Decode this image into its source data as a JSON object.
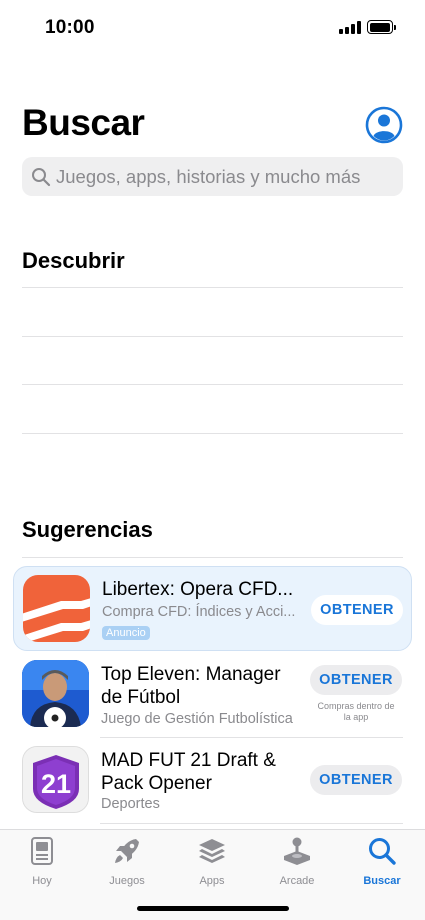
{
  "status_bar": {
    "time": "10:00"
  },
  "header": {
    "title": "Buscar"
  },
  "search": {
    "placeholder": "Juegos, apps, historias y mucho más"
  },
  "discover": {
    "title": "Descubrir"
  },
  "suggestions": {
    "title": "Sugerencias",
    "items": [
      {
        "name": "Libertex: Opera CFD...",
        "subtitle": "Compra CFD: Índices y Acci...",
        "badge": "Anuncio",
        "button": "OBTENER"
      },
      {
        "name_line1": "Top Eleven: Manager",
        "name_line2": "de Fútbol",
        "subtitle": "Juego de Gestión Futbolística",
        "button": "OBTENER",
        "note_line1": "Compras dentro de",
        "note_line2": "la app"
      },
      {
        "name_line1": "MAD FUT 21 Draft &",
        "name_line2": "Pack Opener",
        "subtitle": "Deportes",
        "button": "OBTENER",
        "icon_text": "21"
      }
    ]
  },
  "tab_bar": {
    "tabs": [
      {
        "label": "Hoy",
        "icon": "today-icon"
      },
      {
        "label": "Juegos",
        "icon": "rocket-icon"
      },
      {
        "label": "Apps",
        "icon": "stack-icon"
      },
      {
        "label": "Arcade",
        "icon": "joystick-icon"
      },
      {
        "label": "Buscar",
        "icon": "search-icon",
        "active": true
      }
    ]
  },
  "colors": {
    "accent": "#1a76d8",
    "ad_background": "#e9f3fd",
    "secondary_text": "#8a8a8e"
  }
}
